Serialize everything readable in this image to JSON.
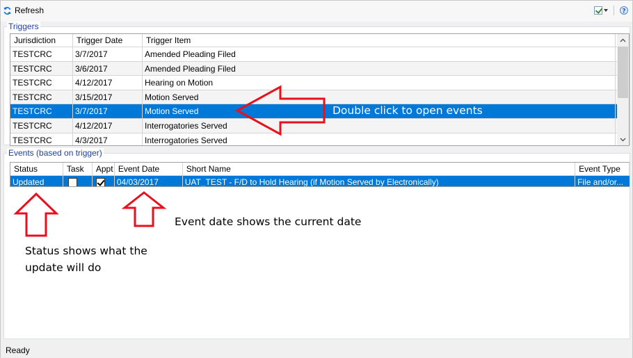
{
  "toolbar": {
    "refresh_label": "Refresh",
    "icons": [
      "refresh-icon",
      "checkbox-dropdown-icon",
      "help-icon"
    ]
  },
  "triggers": {
    "legend": "Triggers",
    "columns": [
      "Jurisdiction",
      "Trigger Date",
      "Trigger Item"
    ],
    "rows": [
      {
        "jurisdiction": "TESTCRC",
        "date": "3/7/2017",
        "item": "Amended Pleading Filed"
      },
      {
        "jurisdiction": "TESTCRC",
        "date": "3/6/2017",
        "item": "Amended Pleading Filed"
      },
      {
        "jurisdiction": "TESTCRC",
        "date": "4/12/2017",
        "item": "Hearing on Motion"
      },
      {
        "jurisdiction": "TESTCRC",
        "date": "3/15/2017",
        "item": "Motion Served"
      },
      {
        "jurisdiction": "TESTCRC",
        "date": "3/7/2017",
        "item": "Motion Served"
      },
      {
        "jurisdiction": "TESTCRC",
        "date": "4/12/2017",
        "item": "Interrogatories Served"
      },
      {
        "jurisdiction": "TESTCRC",
        "date": "4/3/2017",
        "item": "Interrogatories Served"
      }
    ],
    "selected_row_index": 4
  },
  "events": {
    "legend": "Events (based on trigger)",
    "columns": [
      "Status",
      "Task",
      "Appt",
      "Event Date",
      "Short Name",
      "Event Type"
    ],
    "rows": [
      {
        "status": "Updated",
        "task": false,
        "appt": true,
        "event_date": "04/03/2017",
        "short_name": "UAT_TEST - F/D to Hold Hearing (if Motion Served by Electronically)",
        "event_type": "File and/or..."
      }
    ]
  },
  "statusbar": {
    "text": "Ready"
  },
  "annotations": {
    "double_click": "Double click to open events",
    "event_date": "Event date shows the current date",
    "status_line1": "Status shows what the",
    "status_line2": "update will do",
    "arrow_color": "#e8101c"
  },
  "colors": {
    "selection": "#0078d7",
    "legend": "#1e3fa8"
  }
}
